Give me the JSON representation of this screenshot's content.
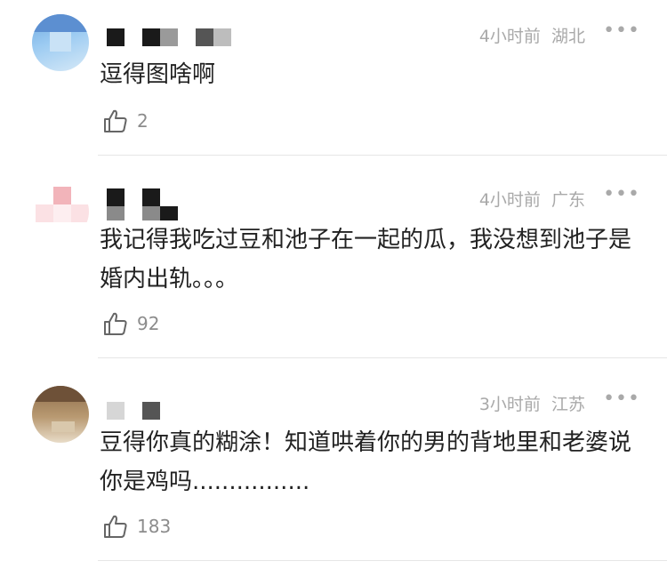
{
  "comments": [
    {
      "username": "",
      "time": "4小时前",
      "location": "湖北",
      "text": "逗得图啥啊",
      "likes": "2",
      "more_icon": "more-dots-icon",
      "like_icon": "thumbs-up-icon"
    },
    {
      "username": "",
      "time": "4小时前",
      "location": "广东",
      "text": "我记得我吃过豆和池子在一起的瓜，我没想到池子是婚内出轨。。。",
      "likes": "92",
      "more_icon": "more-dots-icon",
      "like_icon": "thumbs-up-icon"
    },
    {
      "username": "",
      "time": "3小时前",
      "location": "江苏",
      "text": "豆得你真的糊涂！知道哄着你的男的背地里和老婆说你是鸡吗................",
      "likes": "183",
      "more_icon": "more-dots-icon",
      "like_icon": "thumbs-up-icon"
    }
  ]
}
